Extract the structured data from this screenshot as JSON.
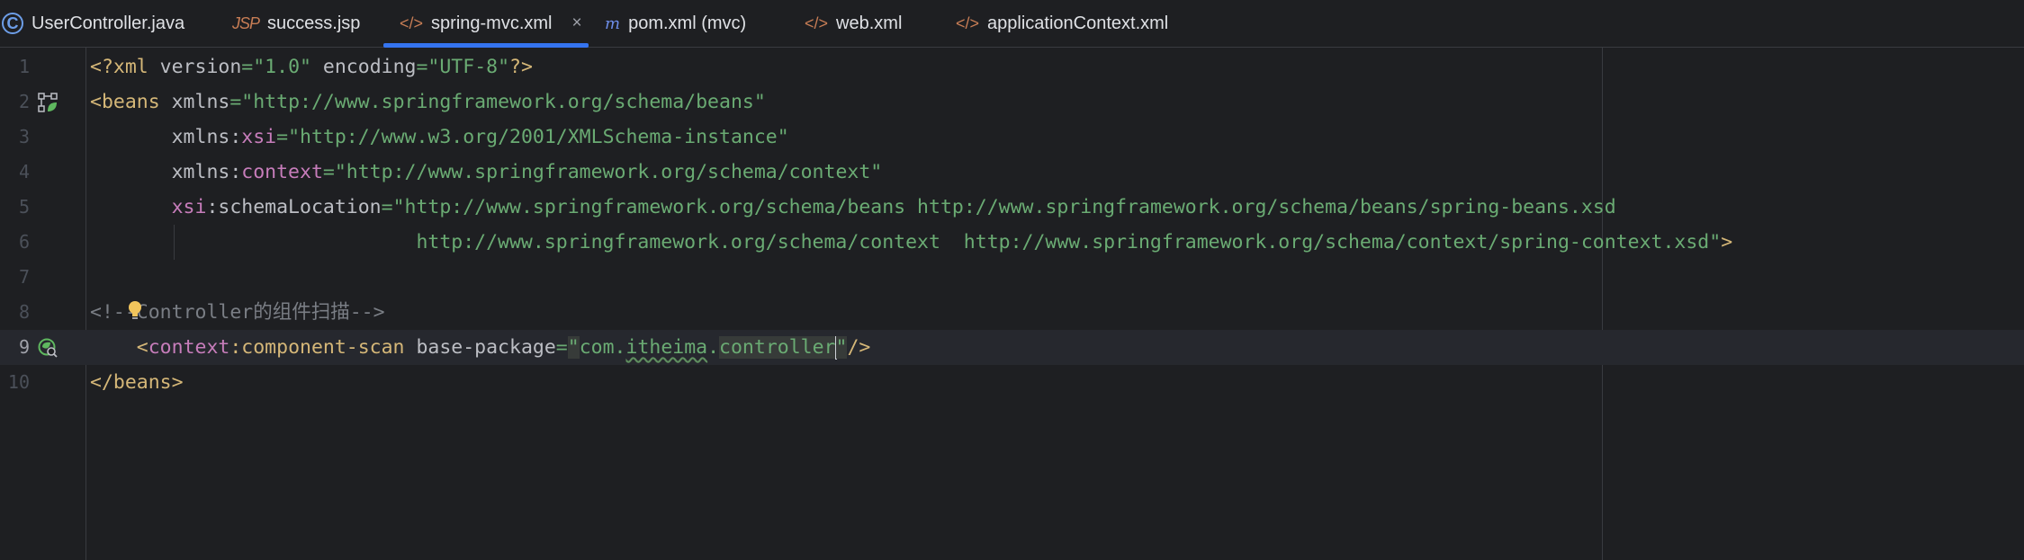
{
  "tabs": [
    {
      "icon": "java-class-icon",
      "glyph": "C",
      "label": "UserController.java"
    },
    {
      "icon": "jsp-file-icon",
      "glyph": "JSP",
      "label": "success.jsp"
    },
    {
      "icon": "xml-file-icon",
      "glyph": "</>",
      "label": "spring-mvc.xml",
      "active": true,
      "close": "×"
    },
    {
      "icon": "maven-icon",
      "glyph": "m",
      "label": "pom.xml (mvc)"
    },
    {
      "icon": "web-xml-icon",
      "glyph": "</>",
      "label": "web.xml"
    },
    {
      "icon": "xml-file-icon",
      "glyph": "</>",
      "label": "applicationContext.xml"
    }
  ],
  "editor": {
    "line_numbers": [
      "1",
      "2",
      "3",
      "4",
      "5",
      "6",
      "7",
      "8",
      "9",
      "10"
    ],
    "current_line": "9",
    "lines": {
      "l1": {
        "p1": "<?",
        "p2": "xml ",
        "p3": "version",
        "p4": "=",
        "p5": "\"1.0\"",
        "p6": " encoding",
        "p7": "=",
        "p8": "\"UTF-8\"",
        "p9": "?>"
      },
      "l2": {
        "p1": "<beans ",
        "p2": "xmlns",
        "p3": "=",
        "p4": "\"http://www.springframework.org/schema/beans\""
      },
      "l3": {
        "p0": "       ",
        "p1": "xmlns:",
        "p2": "xsi",
        "p3": "=",
        "p4": "\"http://www.w3.org/2001/XMLSchema-instance\""
      },
      "l4": {
        "p0": "       ",
        "p1": "xmlns:",
        "p2": "context",
        "p3": "=",
        "p4": "\"http://www.springframework.org/schema/context\""
      },
      "l5": {
        "p0": "       ",
        "p1": "xsi",
        "p2": ":schemaLocation",
        "p3": "=",
        "p4": "\"http://www.springframework.org/schema/beans http://www.springframework.org/schema/beans/spring-beans.xsd"
      },
      "l6": {
        "p0": "                            ",
        "p1": "http://www.springframework.org/schema/context  http://www.springframework.org/schema/context/spring-context.xsd\"",
        "p2": ">"
      },
      "l8": {
        "p1": "<!-",
        "p2": "-Controller的组件扫描-->"
      },
      "l9": {
        "p0": "    ",
        "p1": "<",
        "p2": "context",
        "p3": ":component-scan ",
        "p4": "base-package",
        "p5": "=",
        "p6": "\"",
        "p7": "com.",
        "p8": "itheima",
        "p9": ".",
        "p10": "controller",
        "p11": "\"",
        "p12": "/>"
      },
      "l10": {
        "p1": "</beans>"
      }
    }
  },
  "colors": {
    "background": "#1e1f22",
    "tag": "#d5b778",
    "string": "#6aab73",
    "namespace": "#c77dbb",
    "comment": "#7a7e85",
    "active_tab_underline": "#3574f0"
  }
}
